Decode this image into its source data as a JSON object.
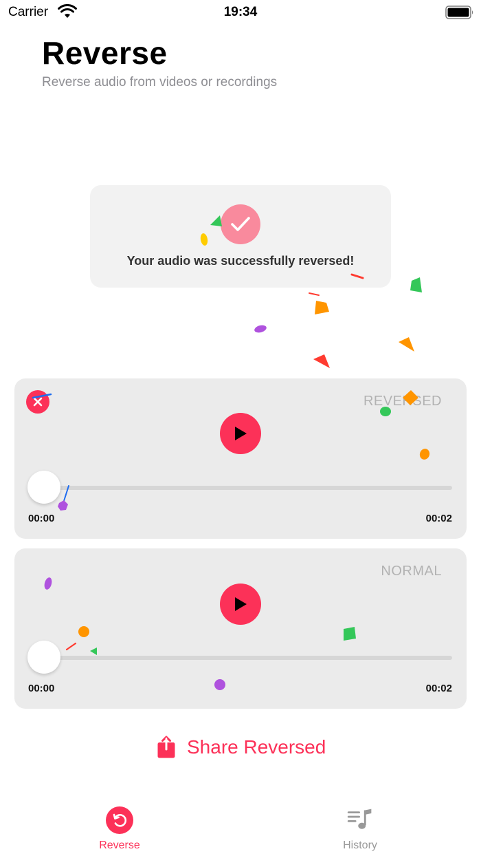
{
  "status_bar": {
    "carrier": "Carrier",
    "time": "19:34"
  },
  "header": {
    "title": "Reverse",
    "subtitle": "Reverse audio from videos or recordings"
  },
  "success": {
    "message": "Your audio was successfully reversed!"
  },
  "players": {
    "reversed": {
      "label": "REVERSED",
      "start_time": "00:00",
      "end_time": "00:02",
      "progress": 0.0
    },
    "normal": {
      "label": "NORMAL",
      "start_time": "00:00",
      "end_time": "00:02",
      "progress": 0.0
    }
  },
  "share": {
    "label": "Share Reversed",
    "icon": "share-icon"
  },
  "tabs": {
    "reverse": {
      "label": "Reverse",
      "icon": "reverse-icon",
      "active": true
    },
    "history": {
      "label": "History",
      "icon": "music-list-icon",
      "active": false
    }
  },
  "colors": {
    "accent": "#fc3158",
    "check_bg": "#f98a9d",
    "card_bg": "#ebebeb",
    "success_card_bg": "#f2f2f2",
    "muted_text": "#8e8e93"
  }
}
